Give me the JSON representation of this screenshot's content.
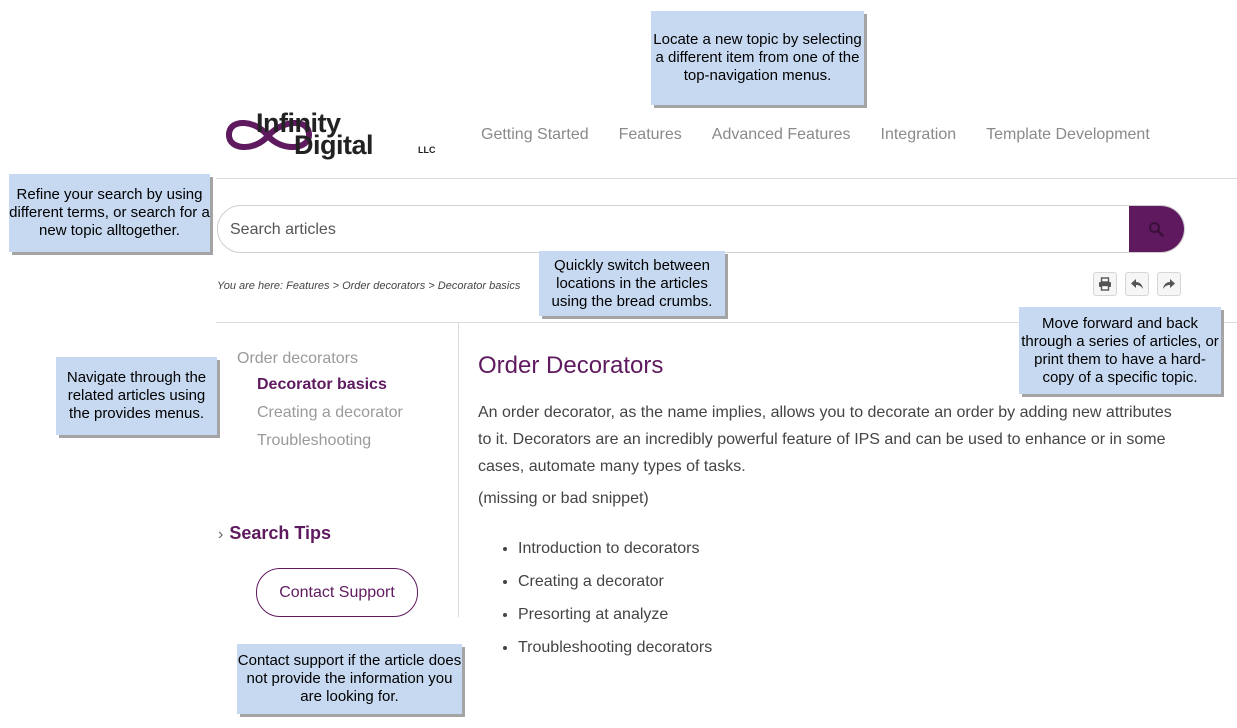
{
  "logo": {
    "word1": "Infinity",
    "word2": "Digital",
    "suffix": "LLC"
  },
  "topnav": [
    "Getting Started",
    "Features",
    "Advanced Features",
    "Integration",
    "Template Development"
  ],
  "search": {
    "placeholder": "Search articles"
  },
  "breadcrumb": {
    "prefix": "You are here: ",
    "items": [
      "Features",
      "Order decorators",
      "Decorator basics"
    ],
    "separator": " > "
  },
  "side_menu": {
    "parent": "Order decorators",
    "items": [
      {
        "label": "Decorator basics",
        "active": true
      },
      {
        "label": "Creating a decorator",
        "active": false
      },
      {
        "label": "Troubleshooting",
        "active": false
      }
    ]
  },
  "search_tips": "Search Tips",
  "contact_button": "Contact Support",
  "article": {
    "title": "Order Decorators",
    "body": "An order decorator, as the name implies, allows you to decorate an order by adding new attributes to it. Decorators are an incredibly powerful feature of IPS and can be used to enhance or in some cases, automate many types of tasks.",
    "snippet": "(missing or bad snippet)",
    "list": [
      "Introduction to decorators",
      "Creating a decorator",
      "Presorting at analyze",
      "Troubleshooting decorators"
    ]
  },
  "callouts": {
    "topnav": "Locate a new topic by selecting a different item from one of the top-navigation menus.",
    "search": "Refine your search by using different terms, or search for a new topic alltogether.",
    "breadcrumb": "Quickly switch between locations in the articles using the bread crumbs.",
    "toolbar": "Move forward and back through a series of articles, or print them to have a hard-copy of a specific topic.",
    "sidemenu": "Navigate through the related articles using the provides menus.",
    "contact": "Contact support if the article does not provide the information you are looking for."
  },
  "colors": {
    "brand": "#5f1a5f",
    "callout_bg": "#c7d9f1",
    "nav_text": "#8a8a8a"
  },
  "icons": [
    "infinity-logo-icon",
    "search-icon",
    "print-icon",
    "back-icon",
    "forward-icon",
    "chevron-right-icon"
  ]
}
